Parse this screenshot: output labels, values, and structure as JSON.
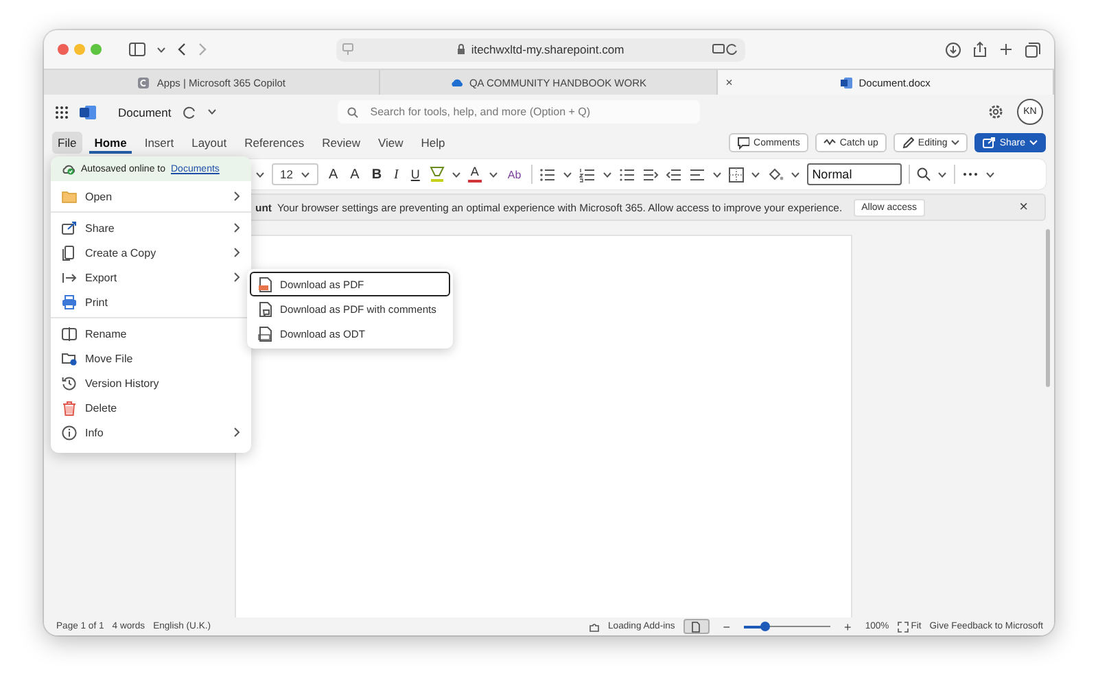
{
  "browser": {
    "address": "itechwxltd-my.sharepoint.com",
    "tabs": [
      {
        "label": "Apps | Microsoft 365 Copilot",
        "selected": false
      },
      {
        "label": "QA COMMUNITY HANDBOOK WORK",
        "selected": false
      },
      {
        "label": "Document.docx",
        "selected": true,
        "close": "×"
      }
    ]
  },
  "app": {
    "title": "Document",
    "search_placeholder": "Search for tools, help, and more (Option + Q)",
    "avatar": "KN"
  },
  "menu_tabs": [
    {
      "label": "File",
      "selected": false,
      "open": true
    },
    {
      "label": "Home",
      "selected": true,
      "open": false
    },
    {
      "label": "Insert",
      "selected": false,
      "open": false
    },
    {
      "label": "Layout",
      "selected": false,
      "open": false
    },
    {
      "label": "References",
      "selected": false,
      "open": false
    },
    {
      "label": "Review",
      "selected": false,
      "open": false
    },
    {
      "label": "View",
      "selected": false,
      "open": false
    },
    {
      "label": "Help",
      "selected": false,
      "open": false
    }
  ],
  "actions": [
    {
      "label": "Comments",
      "kind": "comments"
    },
    {
      "label": "Catch up",
      "kind": "catchup"
    },
    {
      "label": "Editing",
      "kind": "editing"
    },
    {
      "label": "Share",
      "kind": "share"
    }
  ],
  "ribbon": {
    "items": [
      {
        "kind": "chevron"
      },
      {
        "kind": "size",
        "label": "12"
      },
      {
        "kind": "grow",
        "label": "A"
      },
      {
        "kind": "shrink",
        "label": "A"
      },
      {
        "kind": "bold",
        "label": "B"
      },
      {
        "kind": "italic",
        "label": "I"
      },
      {
        "kind": "underline",
        "label": "U"
      },
      {
        "kind": "highlight"
      },
      {
        "kind": "chevron"
      },
      {
        "kind": "font-color",
        "label": "A"
      },
      {
        "kind": "chevron"
      },
      {
        "kind": "effects",
        "label": "Ab"
      },
      {
        "kind": "divider"
      },
      {
        "kind": "bullets"
      },
      {
        "kind": "chevron"
      },
      {
        "kind": "numbering"
      },
      {
        "kind": "chevron"
      },
      {
        "kind": "decrease-indent"
      },
      {
        "kind": "increase-indent"
      },
      {
        "kind": "indent"
      },
      {
        "kind": "align"
      },
      {
        "kind": "chevron"
      },
      {
        "kind": "borders"
      },
      {
        "kind": "chevron"
      },
      {
        "kind": "shading"
      },
      {
        "kind": "chevron"
      },
      {
        "kind": "style",
        "label": "Normal"
      },
      {
        "kind": "divider"
      },
      {
        "kind": "find"
      },
      {
        "kind": "chevron"
      },
      {
        "kind": "divider"
      },
      {
        "kind": "more"
      },
      {
        "kind": "chevron"
      }
    ]
  },
  "notice": {
    "title": "unt",
    "message": "Your browser settings are preventing an optimal experience with Microsoft 365. Allow access to improve your experience.",
    "button": "Allow access",
    "close": "×"
  },
  "file_menu": {
    "autosave": "Autosaved online to",
    "autosave_link": "Documents",
    "sections": [
      [
        {
          "label": "Open",
          "submenu": true
        }
      ],
      [
        {
          "label": "Share",
          "submenu": true
        },
        {
          "label": "Create a Copy",
          "submenu": true
        },
        {
          "label": "Export",
          "submenu": true
        },
        {
          "label": "Print",
          "submenu": false
        }
      ],
      [
        {
          "label": "Rename",
          "submenu": false
        },
        {
          "label": "Move File",
          "submenu": false
        },
        {
          "label": "Version History",
          "submenu": false
        },
        {
          "label": "Delete",
          "submenu": false
        },
        {
          "label": "Info",
          "submenu": true
        }
      ]
    ]
  },
  "export_menu": [
    {
      "label": "Download as PDF",
      "selected": true
    },
    {
      "label": "Download as PDF with comments",
      "selected": false
    },
    {
      "label": "Download as ODT",
      "selected": false
    }
  ],
  "status_bar": {
    "page": "Page 1 of 1",
    "words": "4 words",
    "language": "English (U.K.)",
    "addins": "Loading Add-ins",
    "zoom_out": "−",
    "zoom_in": "+",
    "zoom": "100%",
    "fit": "Fit",
    "feedback": "Give Feedback to Microsoft",
    "zoom_slider": {
      "level": 0.24
    }
  }
}
